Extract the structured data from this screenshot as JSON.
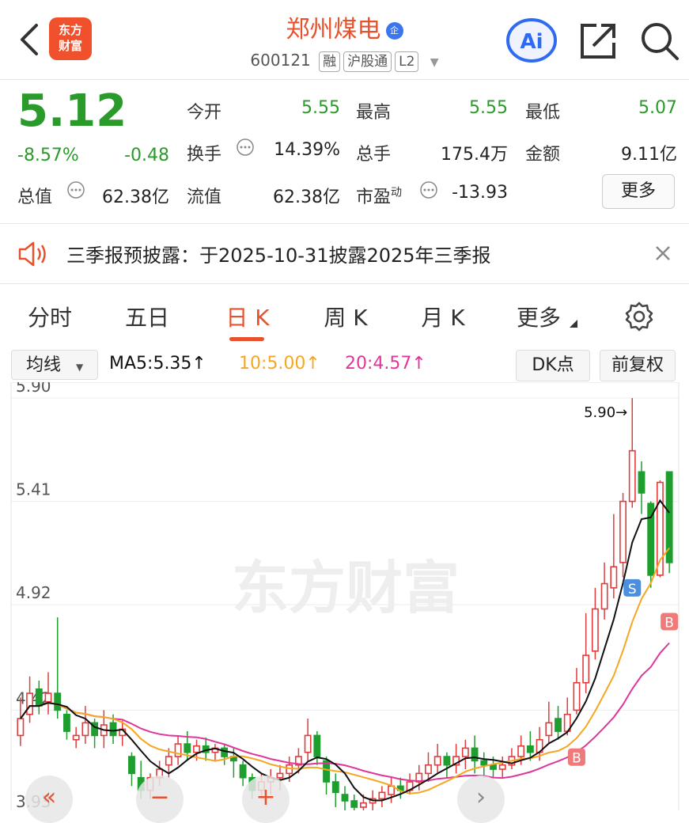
{
  "header": {
    "logo_line1": "东方",
    "logo_line2": "财富",
    "stock_name": "郑州煤电",
    "badge": "企",
    "code": "600121",
    "tags": [
      "融",
      "沪股通",
      "L2"
    ],
    "ai_label": "Ai"
  },
  "quote": {
    "price": "5.12",
    "change_pct": "-8.57%",
    "change": "-0.48",
    "open_label": "今开",
    "open": "5.55",
    "high_label": "最高",
    "high": "5.55",
    "low_label": "最低",
    "low": "5.07",
    "turnover_label": "换手",
    "turnover": "14.39%",
    "volume_label": "总手",
    "volume": "175.4万",
    "amount_label": "金额",
    "amount": "9.11亿",
    "mktcap_label": "总值",
    "mktcap": "62.38亿",
    "float_label": "流值",
    "float": "62.38亿",
    "pe_label": "市盈",
    "pe_sup": "动",
    "pe": "-13.93",
    "more": "更多"
  },
  "notice": {
    "text": "三季报预披露：于2025-10-31披露2025年三季报"
  },
  "tabs": [
    "分时",
    "五日",
    "日 K",
    "周 K",
    "月 K",
    "更多"
  ],
  "active_tab": "日 K",
  "toolbar": {
    "ma_select": "均线",
    "ma5": "MA5:5.35↑",
    "ma10": "10:5.00↑",
    "ma20": "20:4.57↑",
    "dk": "DK点",
    "fq": "前复权"
  },
  "colors": {
    "up": "#e23b3b",
    "down": "#1e9e2e",
    "accent": "#e8512d",
    "ma5": "#111111",
    "ma10": "#f5a623",
    "ma20": "#e0359b"
  },
  "chart_data": {
    "type": "candlestick",
    "y_ticks": [
      "5.90",
      "5.41",
      "4.92",
      "4.42",
      "3.93"
    ],
    "max_marker": "5.90→",
    "watermark": "东方财富",
    "signals": {
      "sell": "S",
      "buy": "B"
    },
    "candles": [
      [
        4.3,
        4.38,
        4.25,
        4.48
      ],
      [
        4.4,
        4.5,
        4.36,
        4.58
      ],
      [
        4.52,
        4.44,
        4.4,
        4.56
      ],
      [
        4.46,
        4.5,
        4.4,
        4.6
      ],
      [
        4.5,
        4.42,
        4.38,
        4.86
      ],
      [
        4.4,
        4.32,
        4.28,
        4.42
      ],
      [
        4.28,
        4.3,
        4.24,
        4.34
      ],
      [
        4.3,
        4.36,
        4.26,
        4.44
      ],
      [
        4.36,
        4.3,
        4.24,
        4.38
      ],
      [
        4.3,
        4.35,
        4.24,
        4.42
      ],
      [
        4.36,
        4.3,
        4.26,
        4.4
      ],
      [
        4.3,
        4.33,
        4.25,
        4.37
      ],
      [
        4.2,
        4.12,
        4.06,
        4.22
      ],
      [
        4.1,
        4.04,
        4.0,
        4.18
      ],
      [
        4.04,
        4.1,
        4.0,
        4.12
      ],
      [
        4.1,
        4.14,
        4.06,
        4.18
      ],
      [
        4.16,
        4.2,
        4.1,
        4.24
      ],
      [
        4.2,
        4.26,
        4.16,
        4.3
      ],
      [
        4.26,
        4.22,
        4.18,
        4.32
      ],
      [
        4.22,
        4.25,
        4.18,
        4.28
      ],
      [
        4.25,
        4.22,
        4.18,
        4.29
      ],
      [
        4.22,
        4.24,
        4.18,
        4.26
      ],
      [
        4.24,
        4.2,
        4.16,
        4.26
      ],
      [
        4.2,
        4.18,
        4.1,
        4.24
      ],
      [
        4.16,
        4.1,
        4.06,
        4.18
      ],
      [
        4.1,
        4.04,
        4.0,
        4.12
      ],
      [
        4.04,
        4.08,
        4.0,
        4.12
      ],
      [
        4.08,
        4.1,
        4.02,
        4.14
      ],
      [
        4.1,
        4.12,
        4.04,
        4.16
      ],
      [
        4.12,
        4.16,
        4.08,
        4.2
      ],
      [
        4.16,
        4.2,
        4.12,
        4.24
      ],
      [
        4.22,
        4.3,
        4.18,
        4.38
      ],
      [
        4.3,
        4.2,
        4.16,
        4.32
      ],
      [
        4.18,
        4.08,
        4.02,
        4.2
      ],
      [
        4.08,
        4.03,
        3.96,
        4.12
      ],
      [
        4.02,
        3.99,
        3.94,
        4.06
      ],
      [
        3.99,
        3.96,
        3.92,
        4.02
      ],
      [
        3.96,
        3.98,
        3.93,
        4.02
      ],
      [
        3.98,
        4.0,
        3.94,
        4.04
      ],
      [
        4.0,
        4.03,
        3.96,
        4.06
      ],
      [
        4.02,
        4.06,
        3.98,
        4.1
      ],
      [
        4.06,
        4.04,
        4.0,
        4.1
      ],
      [
        4.04,
        4.08,
        4.02,
        4.12
      ],
      [
        4.08,
        4.12,
        4.04,
        4.16
      ],
      [
        4.12,
        4.16,
        4.08,
        4.22
      ],
      [
        4.16,
        4.2,
        4.12,
        4.26
      ],
      [
        4.2,
        4.16,
        4.1,
        4.22
      ],
      [
        4.16,
        4.2,
        4.12,
        4.26
      ],
      [
        4.2,
        4.24,
        4.14,
        4.28
      ],
      [
        4.24,
        4.18,
        4.12,
        4.3
      ],
      [
        4.18,
        4.16,
        4.1,
        4.22
      ],
      [
        4.16,
        4.14,
        4.1,
        4.2
      ],
      [
        4.14,
        4.16,
        4.1,
        4.2
      ],
      [
        4.16,
        4.2,
        4.14,
        4.24
      ],
      [
        4.2,
        4.25,
        4.16,
        4.3
      ],
      [
        4.25,
        4.22,
        4.18,
        4.32
      ],
      [
        4.22,
        4.28,
        4.18,
        4.34
      ],
      [
        4.3,
        4.36,
        4.26,
        4.46
      ],
      [
        4.38,
        4.32,
        4.28,
        4.44
      ],
      [
        4.32,
        4.4,
        4.3,
        4.48
      ],
      [
        4.42,
        4.55,
        4.4,
        4.62
      ],
      [
        4.55,
        4.68,
        4.5,
        4.88
      ],
      [
        4.7,
        4.9,
        4.66,
        5.0
      ],
      [
        4.9,
        5.02,
        4.85,
        5.12
      ],
      [
        5.0,
        5.1,
        4.95,
        5.35
      ],
      [
        5.12,
        5.41,
        5.05,
        5.45
      ],
      [
        5.41,
        5.65,
        5.38,
        5.9
      ],
      [
        5.55,
        5.45,
        5.35,
        5.6
      ],
      [
        5.4,
        5.06,
        5.0,
        5.41
      ],
      [
        5.06,
        5.5,
        5.05,
        5.51
      ],
      [
        5.55,
        5.12,
        5.07,
        5.55
      ]
    ]
  },
  "chart_controls": [
    "«",
    "−",
    "+",
    "›"
  ]
}
